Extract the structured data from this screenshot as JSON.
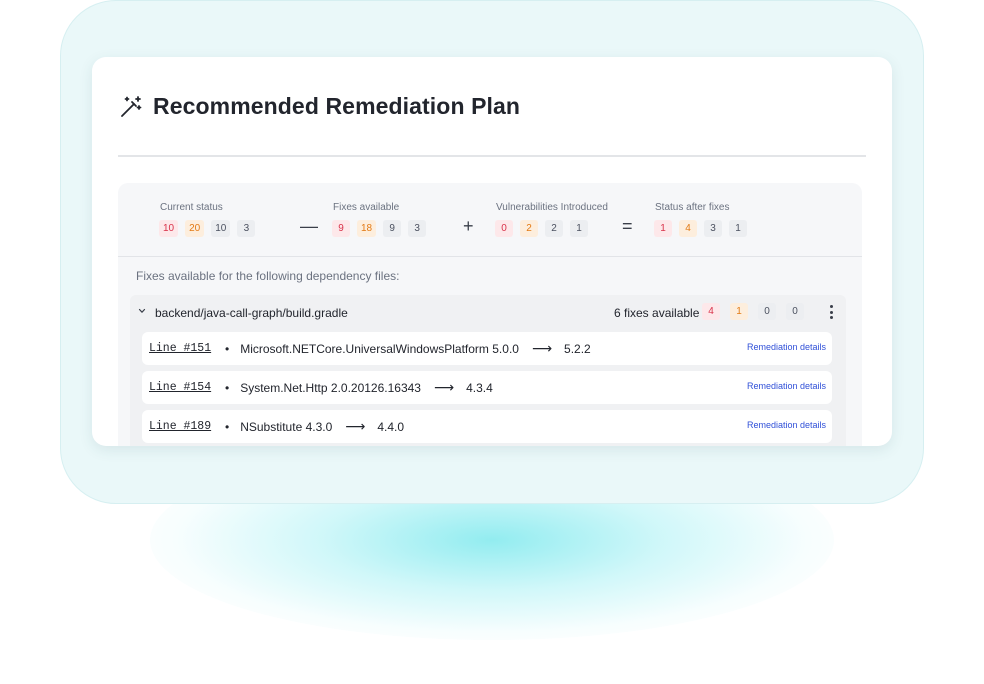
{
  "header": {
    "title": "Recommended Remediation Plan",
    "icon": "magic-wand-icon"
  },
  "summary": {
    "groups": [
      {
        "label": "Current status",
        "counts": [
          "10",
          "20",
          "10",
          "3"
        ]
      },
      {
        "label": "Fixes available",
        "counts": [
          "9",
          "18",
          "9",
          "3"
        ]
      },
      {
        "label": "Vulnerabilities Introduced",
        "counts": [
          "0",
          "2",
          "2",
          "1"
        ]
      },
      {
        "label": "Status after fixes",
        "counts": [
          "1",
          "4",
          "3",
          "1"
        ]
      }
    ],
    "operators": [
      "—",
      "+",
      "="
    ]
  },
  "deps_caption": "Fixes available for the following dependency files:",
  "file": {
    "path": "backend/java-call-graph/build.gradle",
    "fixes_count": "6 fixes available",
    "counts": [
      "4",
      "1",
      "0",
      "0"
    ],
    "fixes": [
      {
        "line": "Line #151",
        "package": "Microsoft.NETCore.UniversalWindowsPlatform 5.0.0",
        "target": "5.2.2",
        "link": "Remediation details"
      },
      {
        "line": "Line #154",
        "package": "System.Net.Http 2.0.20126.16343",
        "target": "4.3.4",
        "link": "Remediation details"
      },
      {
        "line": "Line #189",
        "package": "NSubstitute 4.3.0",
        "target": "4.4.0",
        "link": "Remediation details"
      }
    ],
    "bullet": "•",
    "arrow": "⟶"
  },
  "colors": {
    "critical": "#d9324a",
    "high": "#e37a14",
    "neutral": "#4b5160",
    "link": "#3050d8"
  }
}
